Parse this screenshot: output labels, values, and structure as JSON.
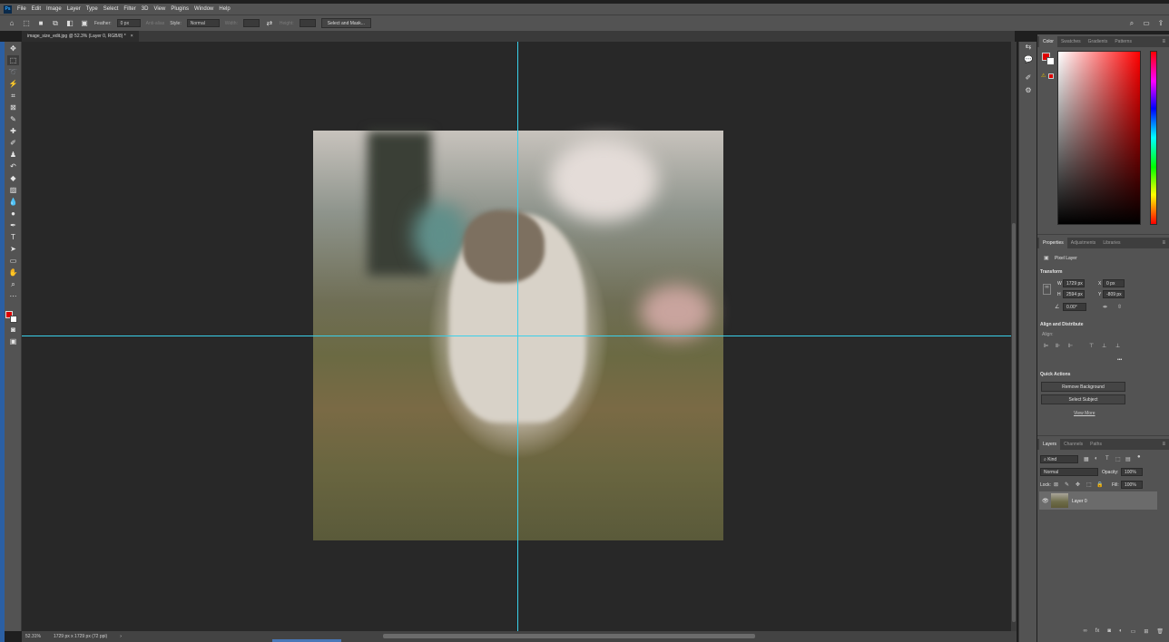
{
  "app": {
    "logo": "Ps"
  },
  "menu": [
    "File",
    "Edit",
    "Image",
    "Layer",
    "Type",
    "Select",
    "Filter",
    "3D",
    "View",
    "Plugins",
    "Window",
    "Help"
  ],
  "options": {
    "feather_label": "Feather:",
    "feather_value": "0 px",
    "antialias_label": "Anti-alias",
    "style_label": "Style:",
    "style_value": "Normal",
    "width_label": "Width:",
    "height_label": "Height:",
    "select_mask_label": "Select and Mask..."
  },
  "document": {
    "tab_title": "image_size_edit.jpg @ 52.3% (Layer 0, RGB/8) *",
    "close": "×"
  },
  "status": {
    "zoom": "52.31%",
    "doc_info": "1729 px x 1729 px (72 ppi)",
    "arrow": "›"
  },
  "color_panel": {
    "tabs": [
      "Color",
      "Swatches",
      "Gradients",
      "Patterns"
    ],
    "menu": "≡",
    "foreground": "#e00000",
    "background": "#ffffff"
  },
  "properties": {
    "tabs": [
      "Properties",
      "Adjustments",
      "Libraries"
    ],
    "layer_type": "Pixel Layer",
    "transform_title": "Transform",
    "w_label": "W",
    "w_value": "1729 px",
    "h_label": "H",
    "h_value": "2594 px",
    "x_label": "X",
    "x_value": "0 px",
    "y_label": "Y",
    "y_value": "-809 px",
    "angle_value": "0.00°",
    "align_title": "Align and Distribute",
    "align_label": "Align:",
    "more": "•••",
    "quick_title": "Quick Actions",
    "remove_bg": "Remove Background",
    "select_subject": "Select Subject",
    "view_more": "View More"
  },
  "layers": {
    "tabs": [
      "Layers",
      "Channels",
      "Paths"
    ],
    "filter_kind": "Kind",
    "blend_mode": "Normal",
    "opacity_label": "Opacity:",
    "opacity_value": "100%",
    "lock_label": "Lock:",
    "fill_label": "Fill:",
    "fill_value": "100%",
    "items": [
      {
        "name": "Layer 0"
      }
    ]
  }
}
